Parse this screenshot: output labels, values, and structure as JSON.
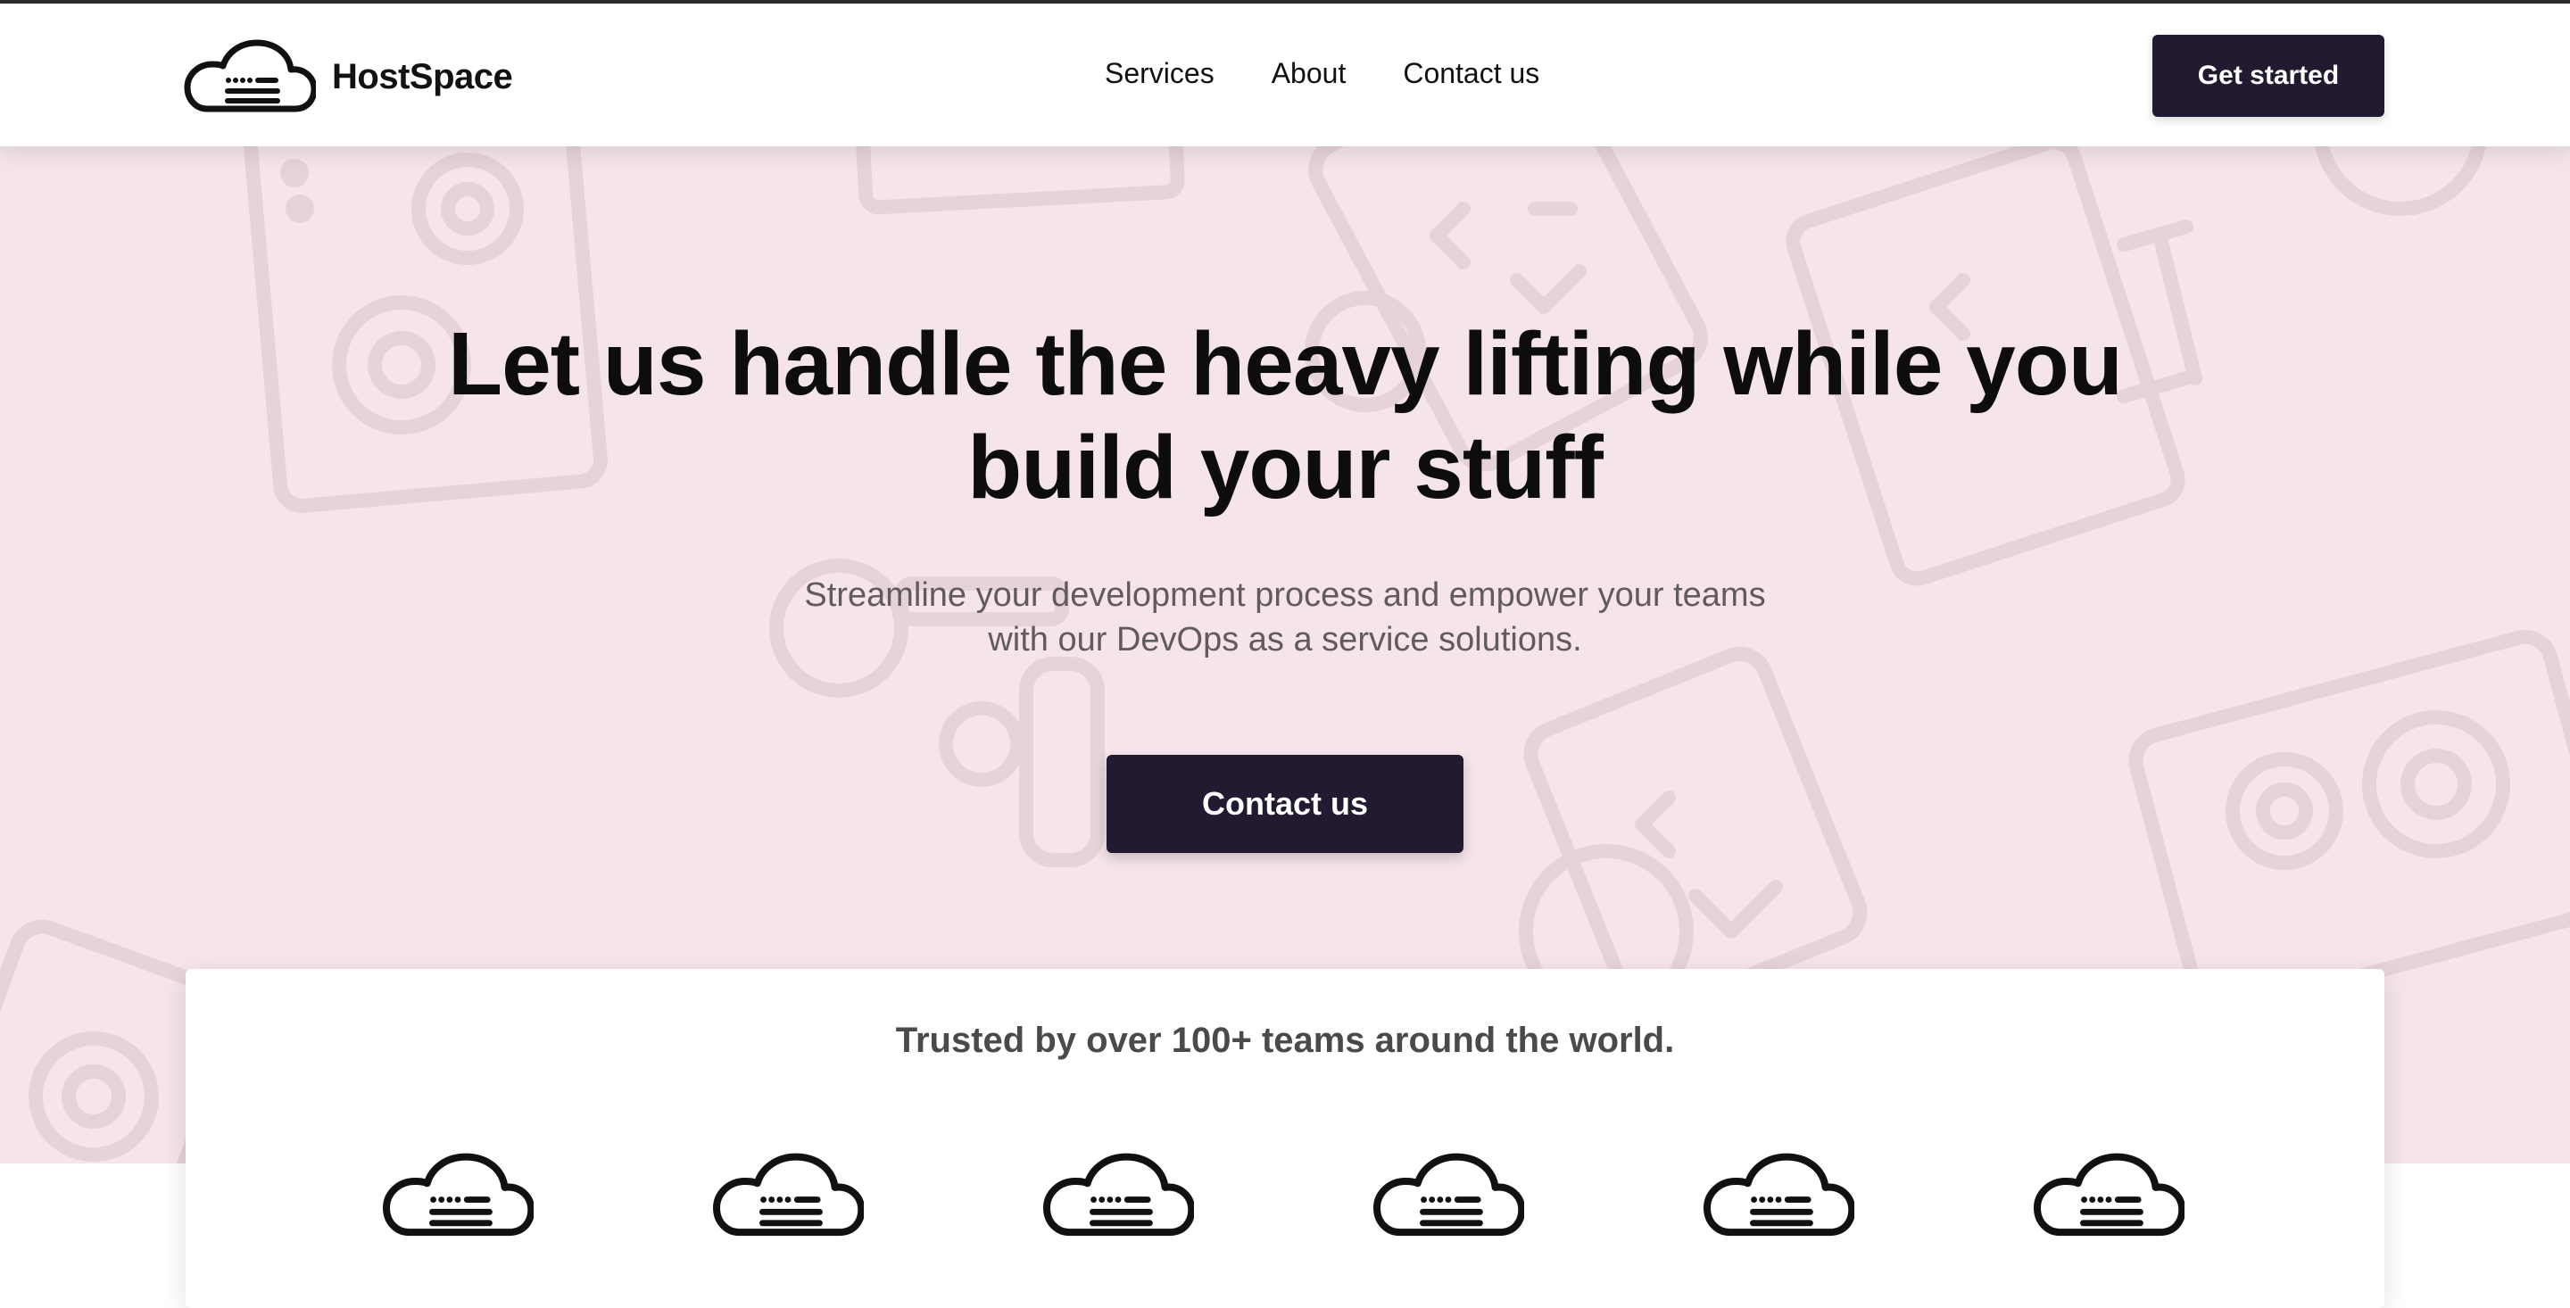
{
  "header": {
    "brand": "HostSpace",
    "nav": [
      {
        "label": "Services"
      },
      {
        "label": "About"
      },
      {
        "label": "Contact us"
      }
    ],
    "cta_label": "Get started"
  },
  "hero": {
    "title": "Let us handle the heavy lifting while you build your stuff",
    "subtitle": "Streamline your development process and empower your teams with our DevOps as a service solutions.",
    "cta_label": "Contact us",
    "background_color": "#f5e5e9"
  },
  "trusted": {
    "text": "Trusted by over 100+ teams around the world.",
    "logos": [
      "cloud-logo",
      "cloud-logo",
      "cloud-logo",
      "cloud-logo",
      "cloud-logo",
      "cloud-logo"
    ]
  },
  "colors": {
    "accent": "#221a30",
    "text": "#0d0d0d",
    "muted": "#615b5e"
  }
}
